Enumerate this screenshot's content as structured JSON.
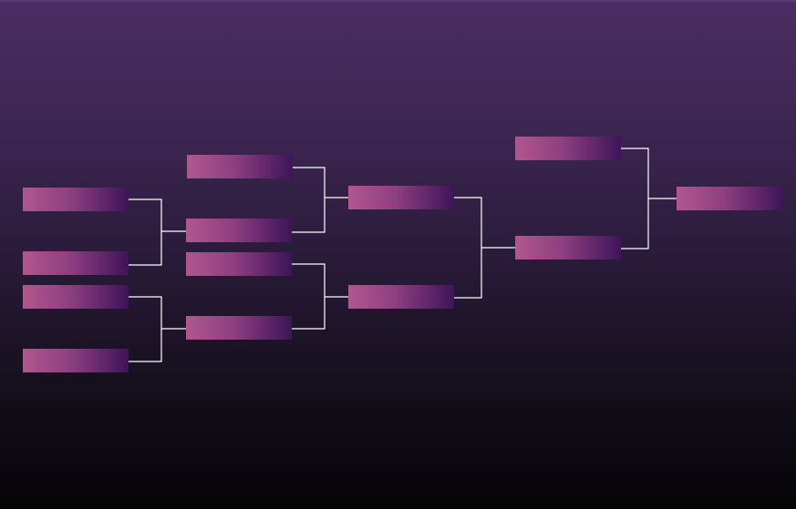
{
  "bracket": {
    "line_color": "#ffffff",
    "slot_gradient": [
      "#b1578e",
      "#8d3f80",
      "#3e1459"
    ],
    "background_gradient": [
      "#4b2d62",
      "#3d2652",
      "#2a1b3a",
      "#15101d",
      "#050406"
    ],
    "rounds": [
      {
        "slots": [
          "",
          "",
          "",
          ""
        ]
      },
      {
        "slots": [
          "",
          "",
          "",
          ""
        ]
      },
      {
        "slots": [
          "",
          ""
        ]
      },
      {
        "slots": [
          "",
          ""
        ]
      },
      {
        "slots": [
          ""
        ]
      }
    ]
  }
}
